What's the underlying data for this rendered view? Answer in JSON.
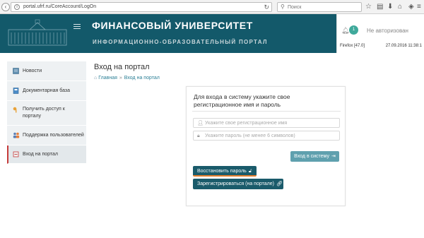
{
  "browser": {
    "url": "portal.ufrf.ru/CoreAccount/LogOn",
    "search_placeholder": "Поиск"
  },
  "header": {
    "title": "ФИНАНСОВЫЙ УНИВЕРСИТЕТ",
    "subtitle": "ИНФОРМАЦИОННО-ОБРАЗОВАТЕЛЬНЫЙ ПОРТАЛ",
    "notifications_count": "1",
    "auth_status": "Не авторизован",
    "browser_version": "Firefox [47.0]",
    "datetime": "27.09.2016 11:38:1"
  },
  "sidebar": {
    "items": [
      {
        "label": "Новости",
        "icon": "news-icon"
      },
      {
        "label": "Документарная база",
        "icon": "docs-icon"
      },
      {
        "label": "Получить доступ к порталу",
        "icon": "key-icon"
      },
      {
        "label": "Поддержка пользователей",
        "icon": "users-icon"
      },
      {
        "label": "Вход на портал",
        "icon": "login-icon"
      }
    ]
  },
  "main": {
    "page_title": "Вход на портал",
    "breadcrumb": {
      "home": "Главная",
      "current": "Вход на портал"
    }
  },
  "login": {
    "heading": "Для входа в систему укажите свое регистрационное имя и пароль",
    "username_placeholder": "Укажите свое регистрационное имя",
    "password_placeholder": "Укажите пароль (не менее 6 символов)",
    "login_button": "Вход в систему",
    "restore_button": "Восстановить пароль",
    "register_button": "Зарегистрироваться (на портале)"
  },
  "colors": {
    "header_bg": "#13596a",
    "badge": "#3fa99b",
    "primary_button": "#1a5b6b",
    "login_button": "#5fa0ae",
    "active_marker": "#c63a3a"
  }
}
